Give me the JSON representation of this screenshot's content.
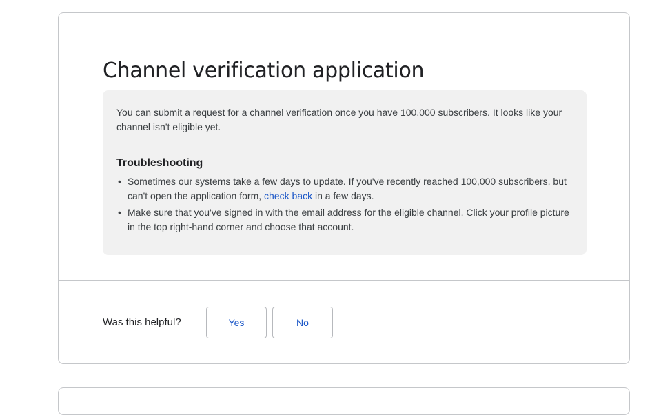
{
  "article": {
    "title": "Channel verification application",
    "notice": {
      "intro": "You can submit a request for a channel verification once you have 100,000 subscribers. It looks like your channel isn't eligible yet.",
      "heading": "Troubleshooting",
      "items": [
        {
          "before": "Sometimes our systems take a few days to update. If you've recently reached 100,000 subscribers, but can't open the application form, ",
          "link": "check back",
          "after": " in a few days."
        },
        {
          "text": "Make sure that you've signed in with the email address for the eligible channel. Click your profile picture in the top right-hand corner and choose that account."
        }
      ]
    }
  },
  "feedback": {
    "question": "Was this helpful?",
    "yes_label": "Yes",
    "no_label": "No"
  },
  "colors": {
    "link": "#1a56c7",
    "notice_background": "#f1f1f1",
    "border": "#c5c7ca"
  }
}
